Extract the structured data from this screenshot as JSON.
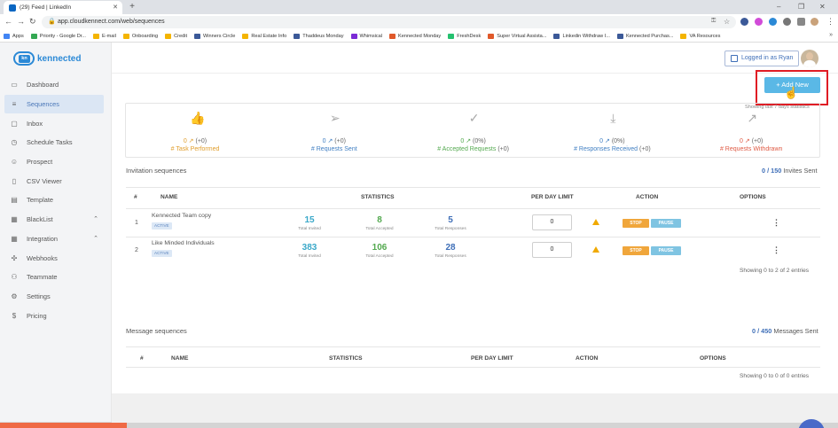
{
  "browser": {
    "tabs": [
      {
        "title": "(29) Feed | LinkedIn",
        "favicon_color": "#0a66c2"
      }
    ],
    "url": "app.cloudkennect.com/web/sequences",
    "bookmarks": [
      {
        "label": "Apps",
        "color": "#4285f4"
      },
      {
        "label": "Priority - Google Dr...",
        "color": "#34a853"
      },
      {
        "label": "E-mail",
        "color": "#f4b400"
      },
      {
        "label": "Onboarding",
        "color": "#f4b400"
      },
      {
        "label": "Credit",
        "color": "#f4b400"
      },
      {
        "label": "Winners Circle",
        "color": "#3b5998"
      },
      {
        "label": "Real Estate Info",
        "color": "#f4b400"
      },
      {
        "label": "Thaddeus Monday",
        "color": "#3b5998"
      },
      {
        "label": "Whimsical",
        "color": "#7b2bd6"
      },
      {
        "label": "Kennected Monday",
        "color": "#e0592a"
      },
      {
        "label": "FreshDesk",
        "color": "#25c16f"
      },
      {
        "label": "Super Virtual Assista...",
        "color": "#e0592a"
      },
      {
        "label": "Linkedin Withdraw I...",
        "color": "#3b5998"
      },
      {
        "label": "Kennected Purchas...",
        "color": "#3b5998"
      },
      {
        "label": "VA Resources",
        "color": "#f4b400"
      }
    ]
  },
  "brand": {
    "name": "kennected",
    "mark": "kn",
    "color": "#2b89d6"
  },
  "sidebar": {
    "items": [
      {
        "label": "Dashboard",
        "icon": "monitor-icon",
        "glyph": "▭",
        "active": false
      },
      {
        "label": "Sequences",
        "icon": "list-icon",
        "glyph": "≡",
        "active": true
      },
      {
        "label": "Inbox",
        "icon": "inbox-icon",
        "glyph": "▢",
        "active": false
      },
      {
        "label": "Schedule Tasks",
        "icon": "clock-icon",
        "glyph": "◷",
        "active": false
      },
      {
        "label": "Prospect",
        "icon": "users-icon",
        "glyph": "☺",
        "active": false
      },
      {
        "label": "CSV Viewer",
        "icon": "file-icon",
        "glyph": "▯",
        "active": false
      },
      {
        "label": "Template",
        "icon": "template-icon",
        "glyph": "▤",
        "active": false
      },
      {
        "label": "BlackList",
        "icon": "blacklist-icon",
        "glyph": "▦",
        "active": false,
        "expandable": true
      },
      {
        "label": "Integration",
        "icon": "integration-icon",
        "glyph": "▦",
        "active": false,
        "expandable": true
      },
      {
        "label": "Webhooks",
        "icon": "webhooks-icon",
        "glyph": "✣",
        "active": false
      },
      {
        "label": "Teammate",
        "icon": "teammate-icon",
        "glyph": "⚇",
        "active": false
      },
      {
        "label": "Settings",
        "icon": "gear-icon",
        "glyph": "⚙",
        "active": false
      },
      {
        "label": "Pricing",
        "icon": "pricing-icon",
        "glyph": "$",
        "active": false
      }
    ]
  },
  "topbar": {
    "logged_in_label": "Logged in as Ryan"
  },
  "add_new": {
    "label": "+ Add New"
  },
  "stats_note": "Showing last 7 days statistics",
  "stats": [
    {
      "value": "0",
      "delta": "(+0)",
      "label": "# Task Performed",
      "color": "#e09e2c",
      "icon": "thumbs-up-icon",
      "glyph": "👍"
    },
    {
      "value": "0",
      "delta": "(+0)",
      "label": "# Requests Sent",
      "color": "#3f7ec2",
      "icon": "paper-plane-icon",
      "glyph": "➢"
    },
    {
      "value": "0",
      "delta": "(0%)",
      "label": "# Accepted Requests",
      "label_suffix": "(+0)",
      "color": "#53a94f",
      "icon": "check-circle-icon",
      "glyph": "✓"
    },
    {
      "value": "0",
      "delta": "(0%)",
      "label": "# Responses Received",
      "label_suffix": "(+0)",
      "color": "#3f7ec2",
      "icon": "download-icon",
      "glyph": "⤓"
    },
    {
      "value": "0",
      "delta": "(+0)",
      "label": "# Requests Withdrawn",
      "color": "#df5b45",
      "icon": "external-link-icon",
      "glyph": "↗"
    }
  ],
  "invitation": {
    "title": "Invitation sequences",
    "count": "0 / 150",
    "count_suffix": "Invites Sent",
    "headers": {
      "num": "#",
      "name": "NAME",
      "statistics": "STATISTICS",
      "per_day_limit": "PER DAY LIMIT",
      "action": "ACTION",
      "options": "OPTIONS"
    },
    "rows": [
      {
        "index": "1",
        "name": "Kennected Team copy",
        "status": "ACTIVE",
        "invited": "15",
        "invited_label": "Total Invited",
        "accepted": "8",
        "accepted_label": "Total Accepted",
        "responses": "5",
        "responses_label": "Total Responses",
        "limit": "0",
        "stop": "STOP",
        "pause": "PAUSE"
      },
      {
        "index": "2",
        "name": "Like Minded Individuals",
        "status": "ACTIVE",
        "invited": "383",
        "invited_label": "Total Invited",
        "accepted": "106",
        "accepted_label": "Total Accepted",
        "responses": "28",
        "responses_label": "Total Responses",
        "limit": "0",
        "stop": "STOP",
        "pause": "PAUSE"
      }
    ],
    "showing": "Showing 0 to 2 of 2 entries"
  },
  "message": {
    "title": "Message sequences",
    "count": "0 / 450",
    "count_suffix": "Messages Sent",
    "headers": {
      "num": "#",
      "name": "NAME",
      "statistics": "STATISTICS",
      "per_day_limit": "PER DAY LIMIT",
      "action": "ACTION",
      "options": "OPTIONS"
    },
    "showing": "Showing 0 to 0 of 0 entries"
  },
  "colors": {
    "invited": "#3aa8c9",
    "accepted": "#53a94f",
    "responses": "#3f6fb8",
    "accent": "#5ab8e6",
    "highlight": "#e01c24"
  }
}
